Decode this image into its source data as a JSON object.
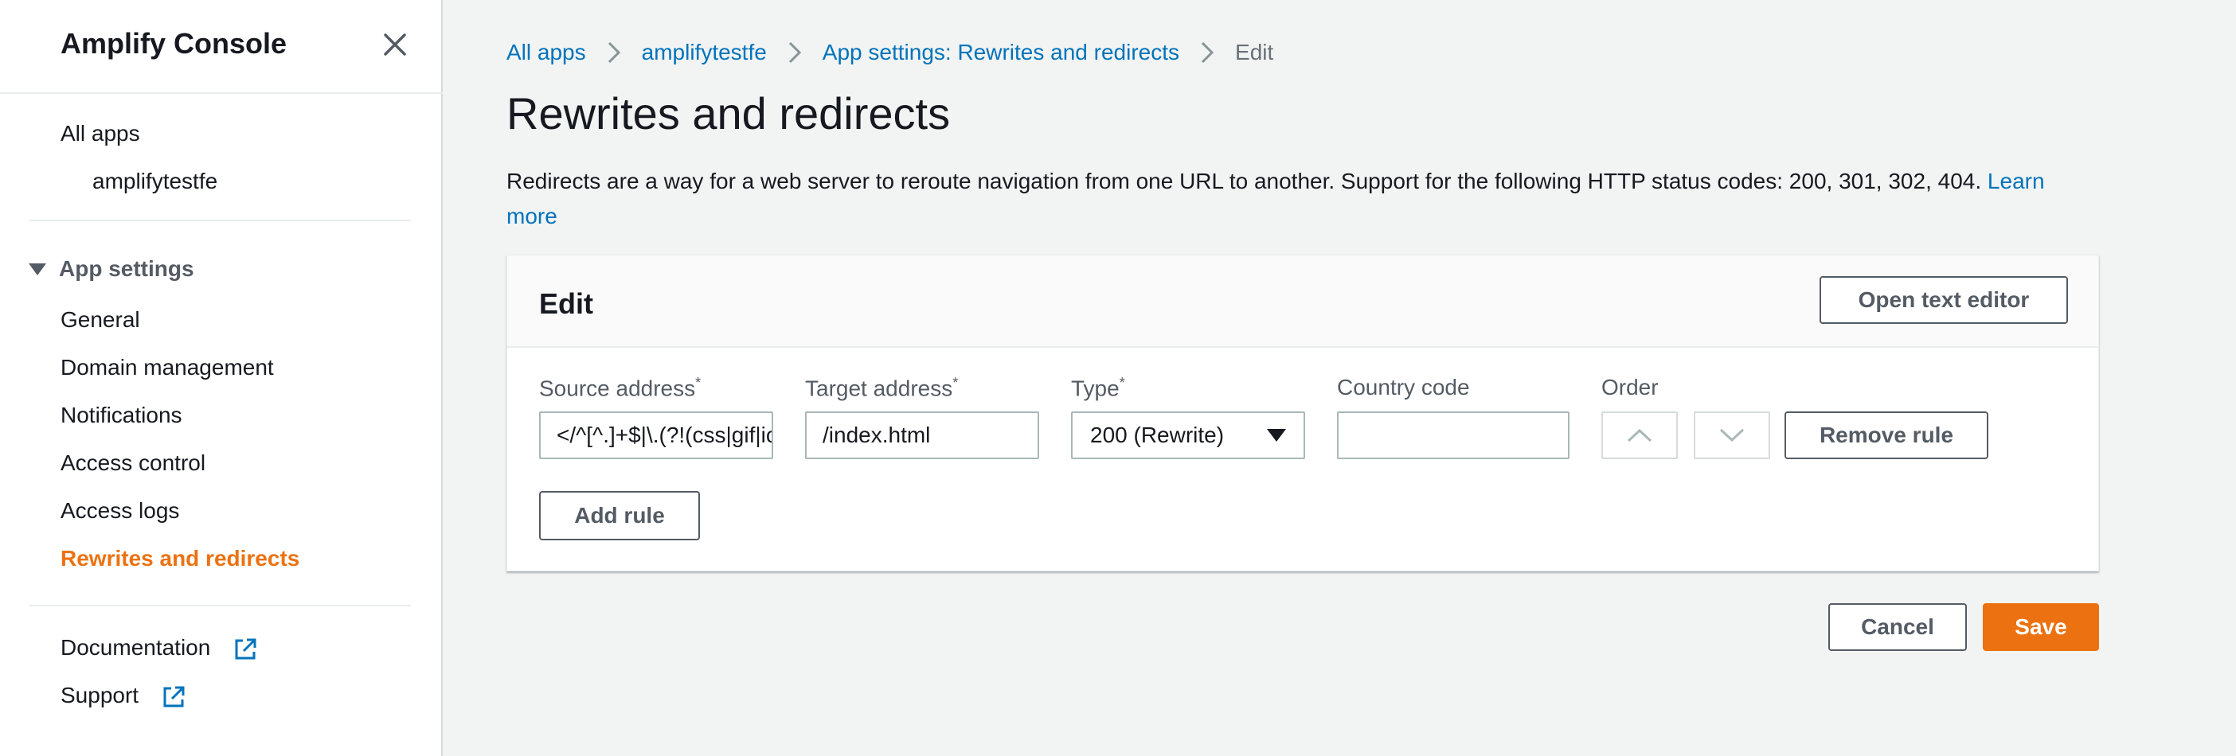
{
  "sidebar": {
    "title": "Amplify Console",
    "all_apps": "All apps",
    "app_name": "amplifytestfe",
    "section_label": "App settings",
    "items": [
      {
        "label": "General"
      },
      {
        "label": "Domain management"
      },
      {
        "label": "Notifications"
      },
      {
        "label": "Access control"
      },
      {
        "label": "Access logs"
      },
      {
        "label": "Rewrites and redirects",
        "active": true
      }
    ],
    "footer_links": [
      {
        "label": "Documentation",
        "icon": "external-link-icon"
      },
      {
        "label": "Support",
        "icon": "external-link-icon"
      }
    ]
  },
  "breadcrumbs": [
    {
      "label": "All apps"
    },
    {
      "label": "amplifytestfe"
    },
    {
      "label": "App settings: Rewrites and redirects"
    },
    {
      "label": "Edit"
    }
  ],
  "page": {
    "title": "Rewrites and redirects",
    "description": "Redirects are a way for a web server to reroute navigation from one URL to another. Support for the following HTTP status codes: 200, 301, 302, 404.",
    "learn_more": "Learn more"
  },
  "edit_panel": {
    "title": "Edit",
    "open_text_editor": "Open text editor",
    "labels": {
      "source": "Source address",
      "target": "Target address",
      "type": "Type",
      "country": "Country code",
      "order": "Order",
      "required_mark": "*"
    },
    "rule": {
      "source": "</^[^.]+$|\\.(?!(css|gif|ico|jpg|js|png|txt|svg|woff|ttf|map|json)$)([^.]+$)/>",
      "target": "/index.html",
      "type": "200 (Rewrite)",
      "country": ""
    },
    "remove_rule": "Remove rule",
    "add_rule": "Add rule"
  },
  "actions": {
    "cancel": "Cancel",
    "save": "Save"
  },
  "colors": {
    "link": "#0073bb",
    "accent": "#ec7211",
    "background": "#f2f3f3"
  }
}
